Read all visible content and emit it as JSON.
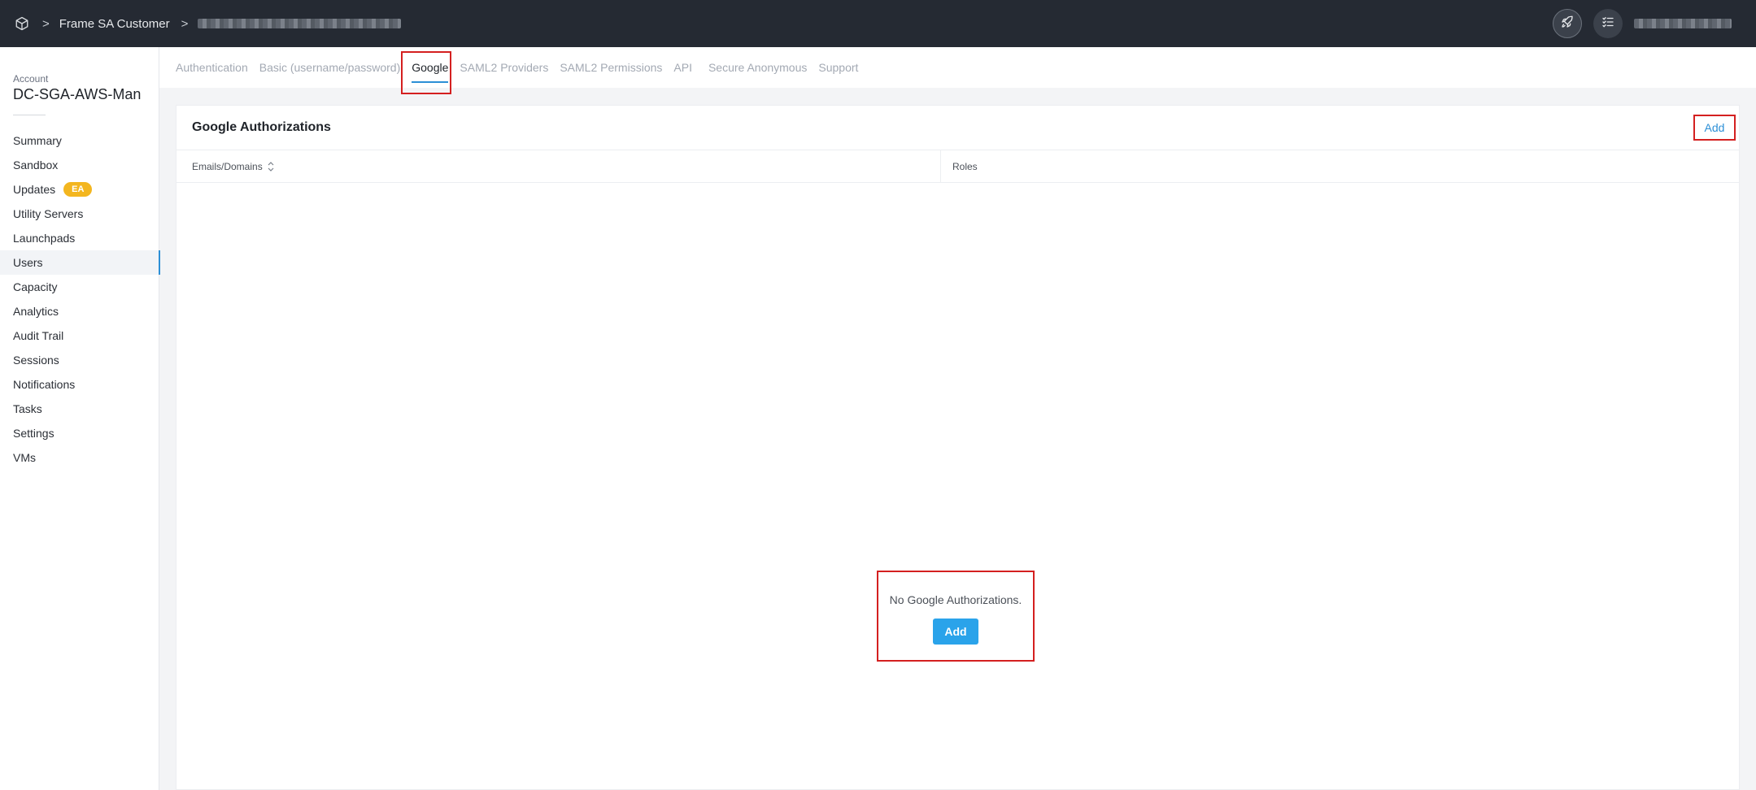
{
  "topbar": {
    "breadcrumb_separator": ">",
    "breadcrumb_customer": "Frame SA Customer",
    "logo_icon": "cube-icon",
    "launch_icon": "rocket-icon",
    "tasks_icon": "checklist-icon"
  },
  "sidebar": {
    "account_label": "Account",
    "account_name": "DC-SGA-AWS-Man",
    "items": [
      {
        "label": "Summary"
      },
      {
        "label": "Sandbox"
      },
      {
        "label": "Updates",
        "badge": "EA"
      },
      {
        "label": "Utility Servers"
      },
      {
        "label": "Launchpads"
      },
      {
        "label": "Users",
        "active": true
      },
      {
        "label": "Capacity"
      },
      {
        "label": "Analytics"
      },
      {
        "label": "Audit Trail"
      },
      {
        "label": "Sessions"
      },
      {
        "label": "Notifications"
      },
      {
        "label": "Tasks"
      },
      {
        "label": "Settings"
      },
      {
        "label": "VMs"
      }
    ]
  },
  "tabs": [
    {
      "label": "Authentication"
    },
    {
      "label": "Basic (username/password)"
    },
    {
      "label": "Google",
      "active": true
    },
    {
      "label": "SAML2 Providers"
    },
    {
      "label": "SAML2 Permissions"
    },
    {
      "label": "API"
    },
    {
      "label": "Secure Anonymous"
    },
    {
      "label": "Support"
    }
  ],
  "card": {
    "title": "Google Authorizations",
    "add_label": "Add",
    "columns": [
      "Emails/Domains",
      "Roles"
    ],
    "empty_text": "No Google Authorizations.",
    "empty_add_label": "Add"
  },
  "colors": {
    "topbar_bg": "#252a33",
    "accent": "#2c8fd6",
    "button_blue": "#2aa3ea",
    "badge_yellow": "#f3b61f",
    "highlight_red": "#d42020"
  }
}
